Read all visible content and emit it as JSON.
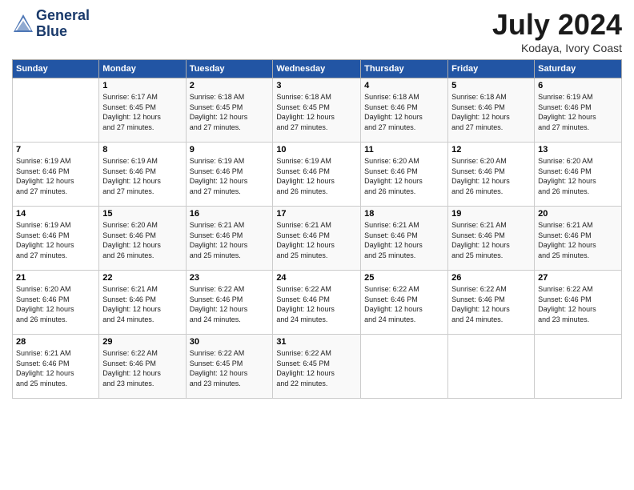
{
  "header": {
    "logo_line1": "General",
    "logo_line2": "Blue",
    "month": "July 2024",
    "location": "Kodaya, Ivory Coast"
  },
  "weekdays": [
    "Sunday",
    "Monday",
    "Tuesday",
    "Wednesday",
    "Thursday",
    "Friday",
    "Saturday"
  ],
  "weeks": [
    [
      {
        "day": "",
        "info": ""
      },
      {
        "day": "1",
        "info": "Sunrise: 6:17 AM\nSunset: 6:45 PM\nDaylight: 12 hours\nand 27 minutes."
      },
      {
        "day": "2",
        "info": "Sunrise: 6:18 AM\nSunset: 6:45 PM\nDaylight: 12 hours\nand 27 minutes."
      },
      {
        "day": "3",
        "info": "Sunrise: 6:18 AM\nSunset: 6:45 PM\nDaylight: 12 hours\nand 27 minutes."
      },
      {
        "day": "4",
        "info": "Sunrise: 6:18 AM\nSunset: 6:46 PM\nDaylight: 12 hours\nand 27 minutes."
      },
      {
        "day": "5",
        "info": "Sunrise: 6:18 AM\nSunset: 6:46 PM\nDaylight: 12 hours\nand 27 minutes."
      },
      {
        "day": "6",
        "info": "Sunrise: 6:19 AM\nSunset: 6:46 PM\nDaylight: 12 hours\nand 27 minutes."
      }
    ],
    [
      {
        "day": "7",
        "info": ""
      },
      {
        "day": "8",
        "info": "Sunrise: 6:19 AM\nSunset: 6:46 PM\nDaylight: 12 hours\nand 27 minutes."
      },
      {
        "day": "9",
        "info": "Sunrise: 6:19 AM\nSunset: 6:46 PM\nDaylight: 12 hours\nand 27 minutes."
      },
      {
        "day": "10",
        "info": "Sunrise: 6:19 AM\nSunset: 6:46 PM\nDaylight: 12 hours\nand 26 minutes."
      },
      {
        "day": "11",
        "info": "Sunrise: 6:20 AM\nSunset: 6:46 PM\nDaylight: 12 hours\nand 26 minutes."
      },
      {
        "day": "12",
        "info": "Sunrise: 6:20 AM\nSunset: 6:46 PM\nDaylight: 12 hours\nand 26 minutes."
      },
      {
        "day": "13",
        "info": "Sunrise: 6:20 AM\nSunset: 6:46 PM\nDaylight: 12 hours\nand 26 minutes."
      }
    ],
    [
      {
        "day": "14",
        "info": ""
      },
      {
        "day": "15",
        "info": "Sunrise: 6:20 AM\nSunset: 6:46 PM\nDaylight: 12 hours\nand 26 minutes."
      },
      {
        "day": "16",
        "info": "Sunrise: 6:21 AM\nSunset: 6:46 PM\nDaylight: 12 hours\nand 25 minutes."
      },
      {
        "day": "17",
        "info": "Sunrise: 6:21 AM\nSunset: 6:46 PM\nDaylight: 12 hours\nand 25 minutes."
      },
      {
        "day": "18",
        "info": "Sunrise: 6:21 AM\nSunset: 6:46 PM\nDaylight: 12 hours\nand 25 minutes."
      },
      {
        "day": "19",
        "info": "Sunrise: 6:21 AM\nSunset: 6:46 PM\nDaylight: 12 hours\nand 25 minutes."
      },
      {
        "day": "20",
        "info": "Sunrise: 6:21 AM\nSunset: 6:46 PM\nDaylight: 12 hours\nand 25 minutes."
      }
    ],
    [
      {
        "day": "21",
        "info": ""
      },
      {
        "day": "22",
        "info": "Sunrise: 6:21 AM\nSunset: 6:46 PM\nDaylight: 12 hours\nand 24 minutes."
      },
      {
        "day": "23",
        "info": "Sunrise: 6:22 AM\nSunset: 6:46 PM\nDaylight: 12 hours\nand 24 minutes."
      },
      {
        "day": "24",
        "info": "Sunrise: 6:22 AM\nSunset: 6:46 PM\nDaylight: 12 hours\nand 24 minutes."
      },
      {
        "day": "25",
        "info": "Sunrise: 6:22 AM\nSunset: 6:46 PM\nDaylight: 12 hours\nand 24 minutes."
      },
      {
        "day": "26",
        "info": "Sunrise: 6:22 AM\nSunset: 6:46 PM\nDaylight: 12 hours\nand 24 minutes."
      },
      {
        "day": "27",
        "info": "Sunrise: 6:22 AM\nSunset: 6:46 PM\nDaylight: 12 hours\nand 23 minutes."
      }
    ],
    [
      {
        "day": "28",
        "info": "Sunrise: 6:22 AM\nSunset: 6:46 PM\nDaylight: 12 hours\nand 23 minutes."
      },
      {
        "day": "29",
        "info": "Sunrise: 6:22 AM\nSunset: 6:46 PM\nDaylight: 12 hours\nand 23 minutes."
      },
      {
        "day": "30",
        "info": "Sunrise: 6:22 AM\nSunset: 6:45 PM\nDaylight: 12 hours\nand 23 minutes."
      },
      {
        "day": "31",
        "info": "Sunrise: 6:22 AM\nSunset: 6:45 PM\nDaylight: 12 hours\nand 22 minutes."
      },
      {
        "day": "",
        "info": ""
      },
      {
        "day": "",
        "info": ""
      },
      {
        "day": "",
        "info": ""
      }
    ]
  ],
  "week1_sun_info": "Sunrise: 6:19 AM\nSunset: 6:46 PM\nDaylight: 12 hours\nand 27 minutes.",
  "week2_sun_info": "Sunrise: 6:19 AM\nSunset: 6:46 PM\nDaylight: 12 hours\nand 27 minutes.",
  "week3_sun_info": "Sunrise: 6:20 AM\nSunset: 6:46 PM\nDaylight: 12 hours\nand 26 minutes.",
  "week4_sun_info": "Sunrise: 6:21 AM\nSunset: 6:46 PM\nDaylight: 12 hours\nand 25 minutes.",
  "week5_sun_info": "Sunrise: 6:21 AM\nSunset: 6:46 PM\nDaylight: 12 hours\nand 25 minutes."
}
